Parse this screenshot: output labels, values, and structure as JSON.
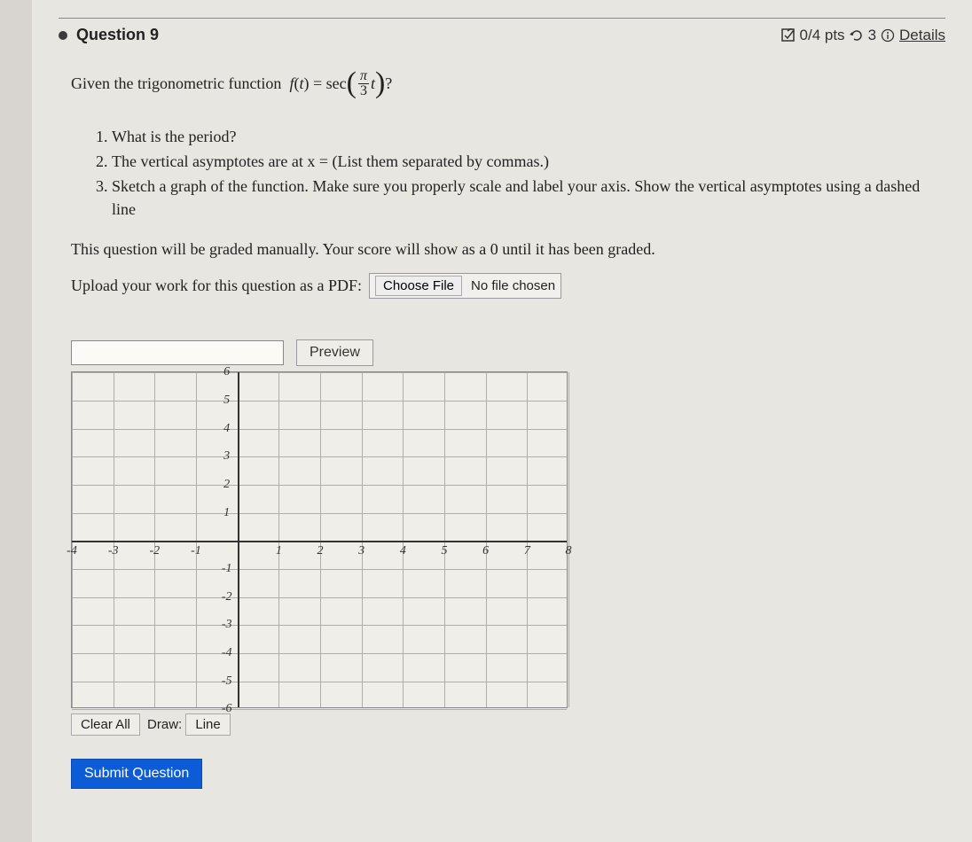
{
  "header": {
    "question_label": "Question 9",
    "points": "0/4 pts",
    "attempts": "3",
    "details": "Details"
  },
  "prompt": {
    "prefix": "Given the trigonometric function",
    "frac_num": "π",
    "frac_den": "3",
    "suffix": "?"
  },
  "questions": [
    "What is the period?",
    "The vertical asymptotes are at x = (List them separated by commas.)",
    "Sketch a graph of the function. Make sure you properly scale and label your axis. Show the vertical asymptotes using a dashed line"
  ],
  "grading_note": "This question will be graded manually. Your score will show as a 0 until it has been graded.",
  "upload": {
    "label": "Upload your work for this question as a PDF:",
    "button": "Choose File",
    "status": "No file chosen"
  },
  "answer": {
    "value": "",
    "preview": "Preview"
  },
  "graph": {
    "clear": "Clear All",
    "draw_label": "Draw:",
    "line": "Line"
  },
  "submit": "Submit Question",
  "chart_data": {
    "type": "scatter",
    "title": "",
    "xlabel": "",
    "ylabel": "",
    "xlim": [
      -4,
      8
    ],
    "ylim": [
      -6,
      6
    ],
    "x_ticks": [
      -4,
      -3,
      -2,
      -1,
      1,
      2,
      3,
      4,
      5,
      6,
      7,
      8
    ],
    "y_ticks": [
      -6,
      -5,
      -4,
      -3,
      -2,
      -1,
      1,
      2,
      3,
      4,
      5,
      6
    ],
    "series": []
  }
}
